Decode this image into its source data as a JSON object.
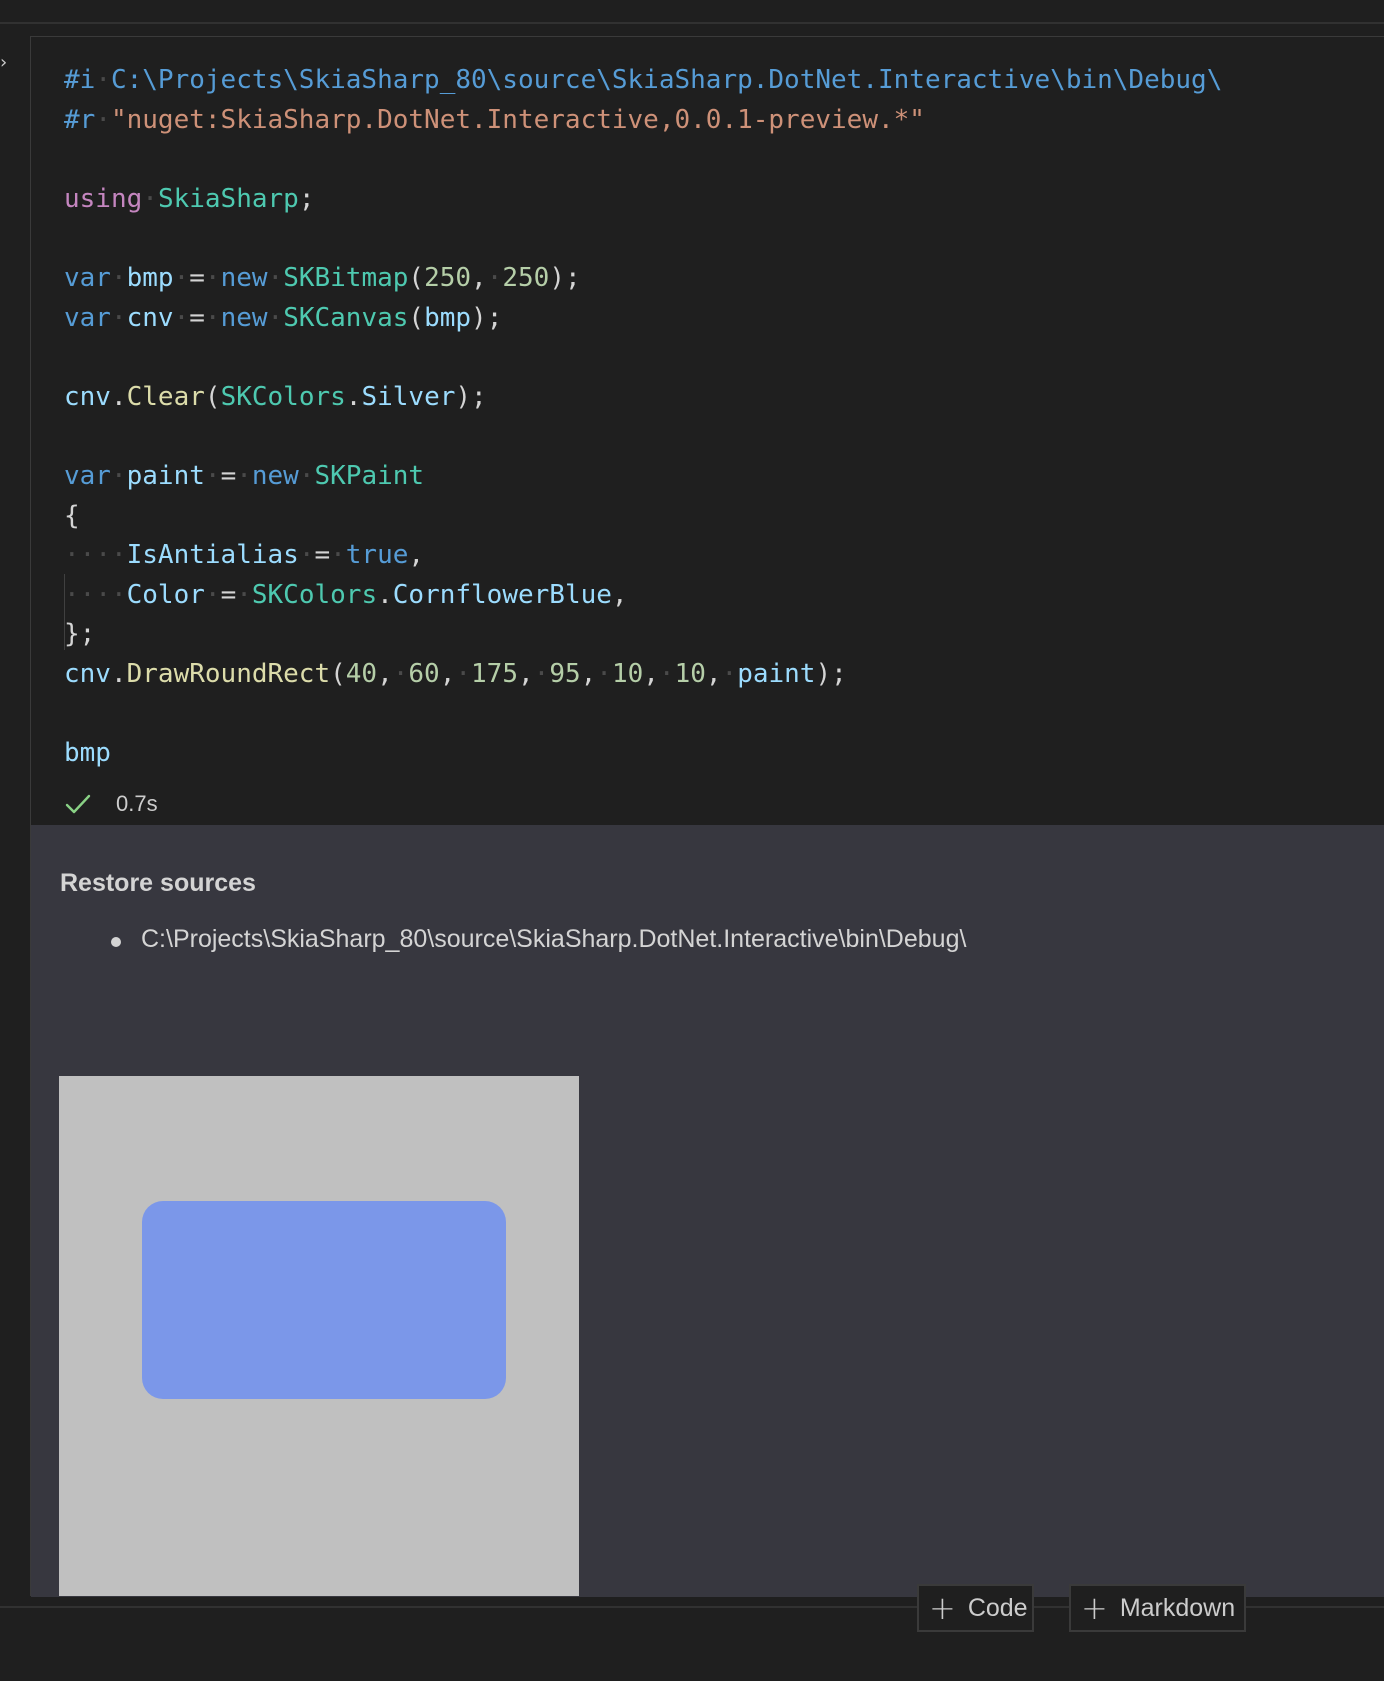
{
  "cell": {
    "code_lines": [
      "#i C:\\Projects\\SkiaSharp_80\\source\\SkiaSharp.DotNet.Interactive\\bin\\Debug\\",
      "#r \"nuget:SkiaSharp.DotNet.Interactive,0.0.1-preview.*\"",
      "",
      "using SkiaSharp;",
      "",
      "var bmp = new SKBitmap(250, 250);",
      "var cnv = new SKCanvas(bmp);",
      "",
      "cnv.Clear(SKColors.Silver);",
      "",
      "var paint = new SKPaint",
      "{",
      "    IsAntialias = true,",
      "    Color = SKColors.CornflowerBlue,",
      "};",
      "cnv.DrawRoundRect(40, 60, 175, 95, 10, 10, paint);",
      "",
      "bmp"
    ],
    "execution_time": "0.7s",
    "status_icon": "check-icon",
    "status_color": "#89d185"
  },
  "output": {
    "restore_title": "Restore sources",
    "restore_items": [
      "C:\\Projects\\SkiaSharp_80\\source\\SkiaSharp.DotNet.Interactive\\bin\\Debug\\"
    ],
    "bitmap": {
      "background_color": "#c0c0c0",
      "rect_color": "#7b97e9"
    }
  },
  "toolbar": {
    "add_code_label": "Code",
    "add_markdown_label": "Markdown",
    "plus_icon": "plus-icon"
  },
  "sidebar": {
    "collapse_icon": "chevron-right-icon"
  },
  "colors": {
    "editor_background": "#1f1f1f",
    "output_background": "#37373f"
  }
}
